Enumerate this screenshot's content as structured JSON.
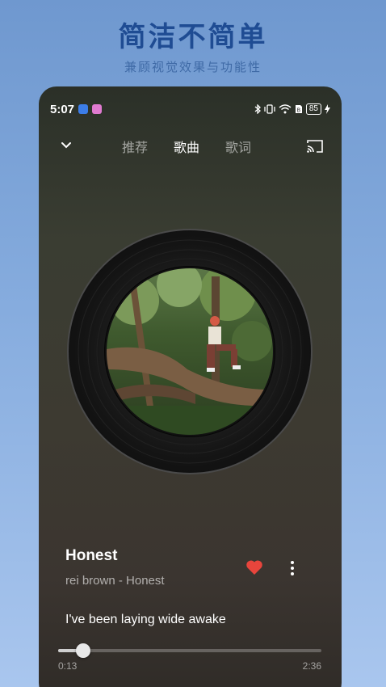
{
  "promo": {
    "headline": "简洁不简单",
    "subline": "兼顾视觉效果与功能性"
  },
  "status_bar": {
    "time": "5:07",
    "battery": "85",
    "app_badge_colors": [
      "#3c7de8",
      "#e07ad0"
    ],
    "icons": [
      "bluetooth-icon",
      "vibrate-icon",
      "wifi-icon",
      "sim-icon",
      "battery-icon",
      "charging-icon"
    ]
  },
  "top_bar": {
    "tabs": [
      {
        "label": "推荐",
        "active": false
      },
      {
        "label": "歌曲",
        "active": true
      },
      {
        "label": "歌词",
        "active": false
      }
    ],
    "left_icon": "chevron-down-icon",
    "right_icon": "cast-icon"
  },
  "song": {
    "title": "Honest",
    "subtitle": "rei brown - Honest",
    "liked": true,
    "current_lyric": "I've been laying wide awake"
  },
  "playback": {
    "current_time": "0:13",
    "total_time": "2:36",
    "progress": 0.096
  },
  "colors": {
    "heart": "#e8453c",
    "headline": "#1f4c93"
  }
}
